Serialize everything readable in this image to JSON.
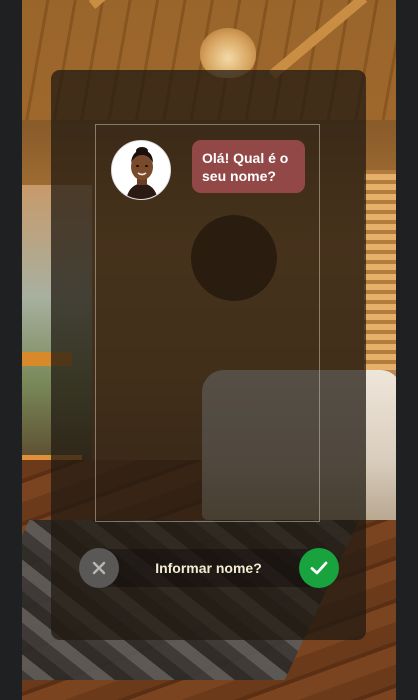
{
  "chat": {
    "message": "Olá! Qual é o seu nome?",
    "bubble_color": "#934848"
  },
  "actions": {
    "prompt": "Informar nome?",
    "cancel_icon": "close-icon",
    "confirm_icon": "check-icon",
    "cancel_color": "#5a5856",
    "confirm_color": "#18a33f"
  },
  "avatar": {
    "icon": "woman-avatar"
  }
}
